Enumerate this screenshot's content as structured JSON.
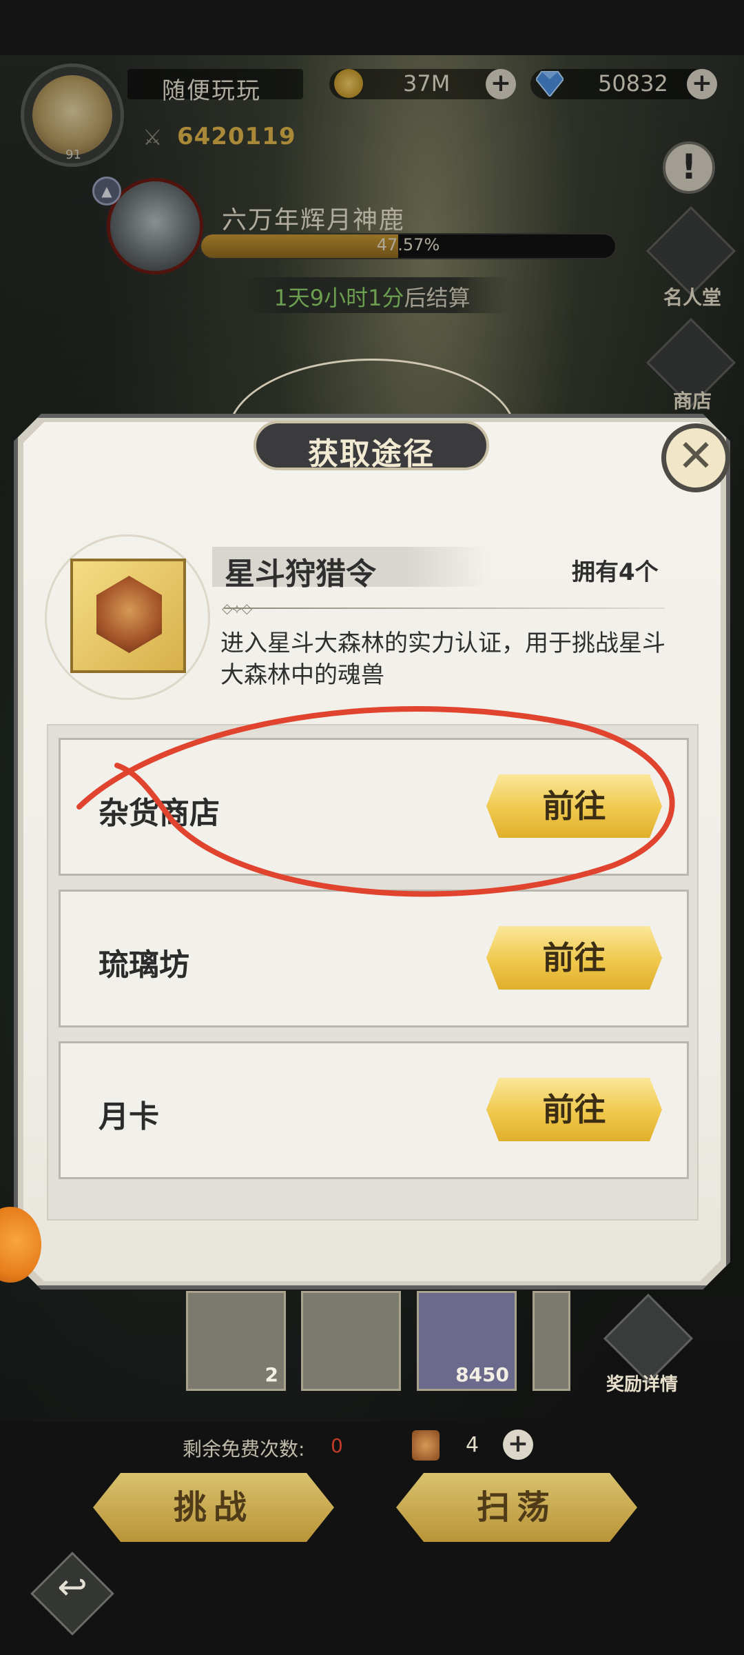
{
  "header": {
    "player_name": "随便玩玩",
    "player_level": "91",
    "combat_power": "6420119",
    "gold": "37M",
    "diamonds": "50832"
  },
  "boss": {
    "name": "六万年辉月神鹿",
    "progress_text": "47.57%",
    "progress_value": 0.4757,
    "timer_prefix": "1天9小时1分",
    "timer_suffix": "后结算"
  },
  "side_menu": {
    "hall_of_fame": "名人堂",
    "shop": "商店",
    "reward_details": "奖励详情"
  },
  "dialog": {
    "title": "获取途径",
    "close_label": "✕",
    "item_name": "星斗狩猎令",
    "owned": "拥有4个",
    "description": "进入星斗大森林的实力认证，用于挑战星斗大森林中的魂兽",
    "sources": [
      {
        "label": "杂货商店",
        "button": "前往"
      },
      {
        "label": "琉璃坊",
        "button": "前往"
      },
      {
        "label": "月卡",
        "button": "前往"
      }
    ]
  },
  "rewards": [
    {
      "qty": "2"
    },
    {
      "qty": ""
    },
    {
      "qty": "8450"
    }
  ],
  "bottom": {
    "free_label": "剩余免费次数:",
    "free_count": "0",
    "ticket_count": "4",
    "challenge_button": "挑战",
    "sweep_button": "扫荡",
    "back_glyph": "↩"
  },
  "colors": {
    "accent_gold": "#e2b64b",
    "progress_green": "#8fd36a",
    "annotation_red": "#e0442f"
  }
}
